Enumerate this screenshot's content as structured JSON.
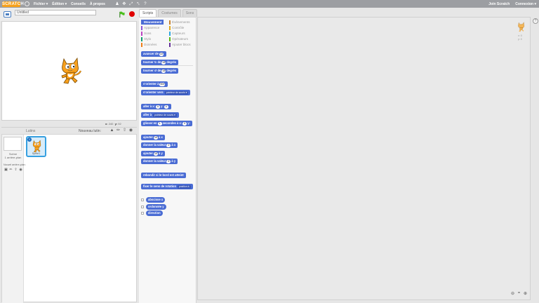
{
  "topbar": {
    "logo": "SCRATCH",
    "menus": [
      "Fichier ▾",
      "Édition ▾",
      "Conseils",
      "À propos"
    ],
    "join": "Join Scratch",
    "connexion": "Connexion ▾"
  },
  "project": {
    "title": "Untitled"
  },
  "stage": {
    "x_label": "x:",
    "x_value": "240",
    "y_label": "y:",
    "y_value": "92"
  },
  "sprites": {
    "label": "Lutins",
    "new_sprite": "Nouveau lutin:",
    "stage_label_1": "Scène",
    "stage_label_2": "1 arrière-plan",
    "new_backdrop": "Nouvel arrière-plan:",
    "sprite_name": "Sprite1",
    "info": "i"
  },
  "tabs": [
    "Scripts",
    "Costumes",
    "Sons"
  ],
  "categories": [
    {
      "left": "Mouvement",
      "left_color": "#4a6cd4",
      "right": "Événements",
      "right_color": "#c88330"
    },
    {
      "left": "Apparence",
      "left_color": "#8a55d7",
      "right": "Contrôle",
      "right_color": "#e1a91a"
    },
    {
      "left": "Sons",
      "left_color": "#bb42c3",
      "right": "Capteurs",
      "right_color": "#2ca5e2"
    },
    {
      "left": "Stylo",
      "left_color": "#0e9a6c",
      "right": "Opérateurs",
      "right_color": "#5cb712"
    },
    {
      "left": "Données",
      "left_color": "#ee7d16",
      "right": "Ajouter blocs",
      "right_color": "#632d99"
    }
  ],
  "blocks": {
    "b1_pre": "avancer de",
    "b1_num": "10",
    "b2_pre": "tourner ↻ de",
    "b2_num": "15",
    "b2_post": "degrés",
    "b3_pre": "tourner ↺ de",
    "b3_num": "15",
    "b3_post": "degrés",
    "b4_pre": "s'orienter à",
    "b4_num": "90▾",
    "b5_pre": "s'orienter vers",
    "b5_drop": "pointeur de souris ▾",
    "b6_pre": "aller à x:",
    "b6_num1": "0",
    "b6_mid": "y:",
    "b6_num2": "0",
    "b7_pre": "aller à",
    "b7_drop": "pointeur de souris ▾",
    "b8_pre": "glisser en",
    "b8_num1": "1",
    "b8_mid": "secondes à x:",
    "b8_num2": "0",
    "b8_post": "y:",
    "b9_pre": "ajouter",
    "b9_num": "10",
    "b9_post": "à x",
    "b10_pre": "donner la valeur",
    "b10_num": "0",
    "b10_post": "à x",
    "b11_pre": "ajouter",
    "b11_num": "10",
    "b11_post": "à y",
    "b12_pre": "donner la valeur",
    "b12_num": "0",
    "b12_post": "à y",
    "b13": "rebondir si le bord est atteint",
    "b14_pre": "fixer le sens de rotation",
    "b14_drop": "position à",
    "r1": "abscisse x",
    "r2": "ordonnée y",
    "r3": "direction"
  },
  "scripts_area": {
    "mini_x": "x: 0",
    "mini_y": "y: 0"
  }
}
